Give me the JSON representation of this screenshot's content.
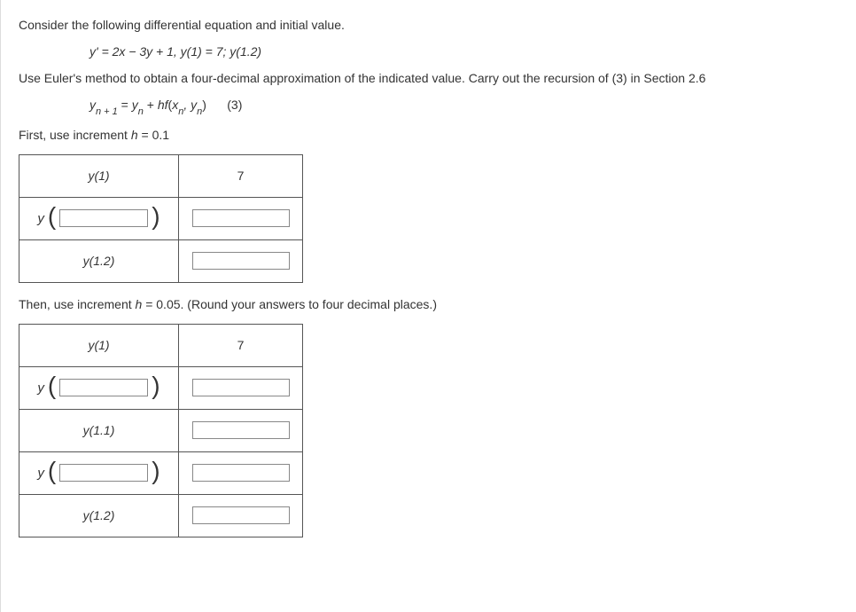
{
  "intro": "Consider the following differential equation and initial value.",
  "equation": "y' = 2x − 3y + 1, y(1) = 7;   y(1.2)",
  "instruction": "Use Euler's method to obtain a four-decimal approximation of the indicated value. Carry out the recursion of (3) in Section 2.6",
  "recursion_lhs": "y",
  "recursion_sub1": "n + 1",
  "recursion_eq": " = ",
  "recursion_rhs1": "y",
  "recursion_sub2": "n",
  "recursion_plus": " + ",
  "recursion_hf": "hf",
  "recursion_paren_open": "(",
  "recursion_x": "x",
  "recursion_sub3": "n",
  "recursion_comma": ", ",
  "recursion_y2": "y",
  "recursion_sub4": "n",
  "recursion_paren_close": ")",
  "recursion_num": "(3)",
  "first_h": "First, use increment ",
  "h_var": "h",
  "first_h_val": " = 0.1",
  "then_h": "Then, use increment ",
  "then_h_val": " = 0.05. (Round your answers to four decimal places.)",
  "table1": {
    "rows": [
      {
        "label": "y(1)",
        "value": "7"
      },
      {
        "label_y": "y",
        "input_label": true
      },
      {
        "label": "y(1.2)"
      }
    ]
  },
  "table2": {
    "rows": [
      {
        "label": "y(1)",
        "value": "7"
      },
      {
        "label_y": "y",
        "input_label": true
      },
      {
        "label": "y(1.1)"
      },
      {
        "label_y": "y",
        "input_label": true
      },
      {
        "label": "y(1.2)"
      }
    ]
  },
  "y_label": "y"
}
